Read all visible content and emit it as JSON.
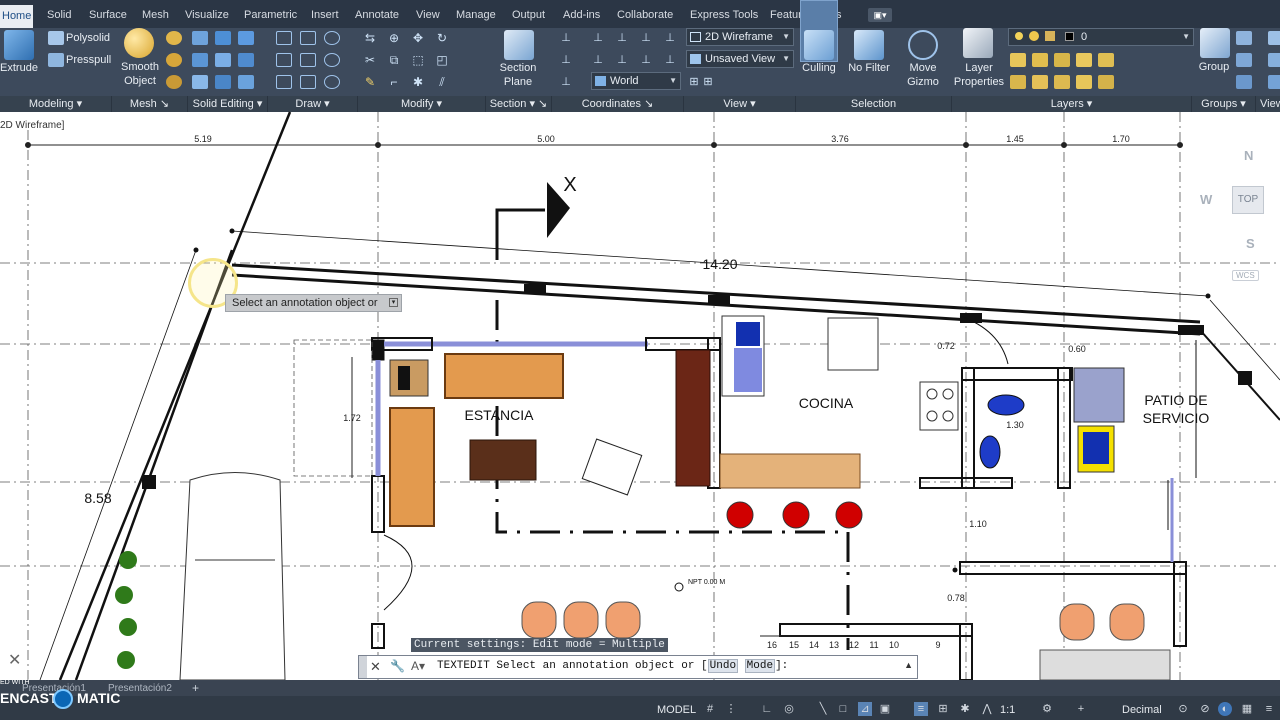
{
  "ribbon_tabs": [
    {
      "label": "Home",
      "active": true
    },
    {
      "label": "Solid"
    },
    {
      "label": "Surface"
    },
    {
      "label": "Mesh"
    },
    {
      "label": "Visualize"
    },
    {
      "label": "Parametric"
    },
    {
      "label": "Insert"
    },
    {
      "label": "Annotate"
    },
    {
      "label": "View"
    },
    {
      "label": "Manage"
    },
    {
      "label": "Output"
    },
    {
      "label": "Add-ins"
    },
    {
      "label": "Collaborate"
    },
    {
      "label": "Express Tools"
    },
    {
      "label": "Featured Apps"
    }
  ],
  "ribbon": {
    "modeling": {
      "extrude": "Extrude",
      "polysolid": "Polysolid",
      "presspull": "Presspull",
      "footer": "Modeling"
    },
    "mesh": {
      "smooth_object_1": "Smooth",
      "smooth_object_2": "Object",
      "footer": "Mesh"
    },
    "solid_editing": {
      "footer": "Solid Editing"
    },
    "draw": {
      "footer": "Draw"
    },
    "modify": {
      "footer": "Modify"
    },
    "section": {
      "plane_1": "Section",
      "plane_2": "Plane",
      "footer": "Section"
    },
    "coordinates": {
      "ucs_world": "World",
      "footer": "Coordinates"
    },
    "view": {
      "visual_style": "2D Wireframe",
      "saved_view": "Unsaved View",
      "footer": "View"
    },
    "selection": {
      "culling": "Culling",
      "no_filter": "No Filter",
      "move_gizmo_1": "Move",
      "move_gizmo_2": "Gizmo",
      "footer": "Selection"
    },
    "layers": {
      "layer_properties_1": "Layer",
      "layer_properties_2": "Properties",
      "current_layer": "0",
      "footer": "Layers"
    },
    "groups": {
      "group": "Group",
      "footer": "Groups"
    },
    "view2": {
      "footer": "View"
    }
  },
  "viewport_label": "2D Wireframe]",
  "navcube": {
    "north": "N",
    "west": "W",
    "south": "S",
    "top": "TOP",
    "wcs": "WCS"
  },
  "drawing": {
    "top_dimensions": [
      "5.19",
      "5.00",
      "3.76",
      "1.45",
      "1.70"
    ],
    "dim_long": "14.20",
    "dim_side": "8.58",
    "dim_072": "0.72",
    "dim_060": "0.60",
    "dim_172": "1.72",
    "dim_130": "1.30",
    "dim_110": "1.10",
    "dim_078": "0.78",
    "section_mark": "X",
    "npt": "NPT 0.00 M",
    "rooms": {
      "estancia": "ESTANCIA",
      "cocina": "COCINA",
      "patio_1": "PATIO DE",
      "patio_2": "SERVICIO"
    },
    "stair_numbers": [
      "16",
      "15",
      "14",
      "13",
      "12",
      "11",
      "10",
      "9"
    ]
  },
  "tooltip": "Select an annotation object or",
  "command": {
    "history": "Current settings: Edit mode = Multiple",
    "prefix": "TEXTEDIT Select an annotation object or [",
    "opt_undo": "Undo",
    "opt_mode": "Mode",
    "suffix": "]:"
  },
  "layout_tabs": [
    "Presentación1",
    "Presentación2"
  ],
  "watermark": {
    "top": "ED WITH",
    "bottom_left": "ENCAST",
    "bottom_right": "MATIC"
  },
  "status": {
    "model": "MODEL",
    "scale": "1:1",
    "units": "Decimal"
  },
  "colors": {
    "ribbon_bg": "#3d4a5c",
    "tab_bg": "#2b3645",
    "accent": "#1f4f86"
  }
}
